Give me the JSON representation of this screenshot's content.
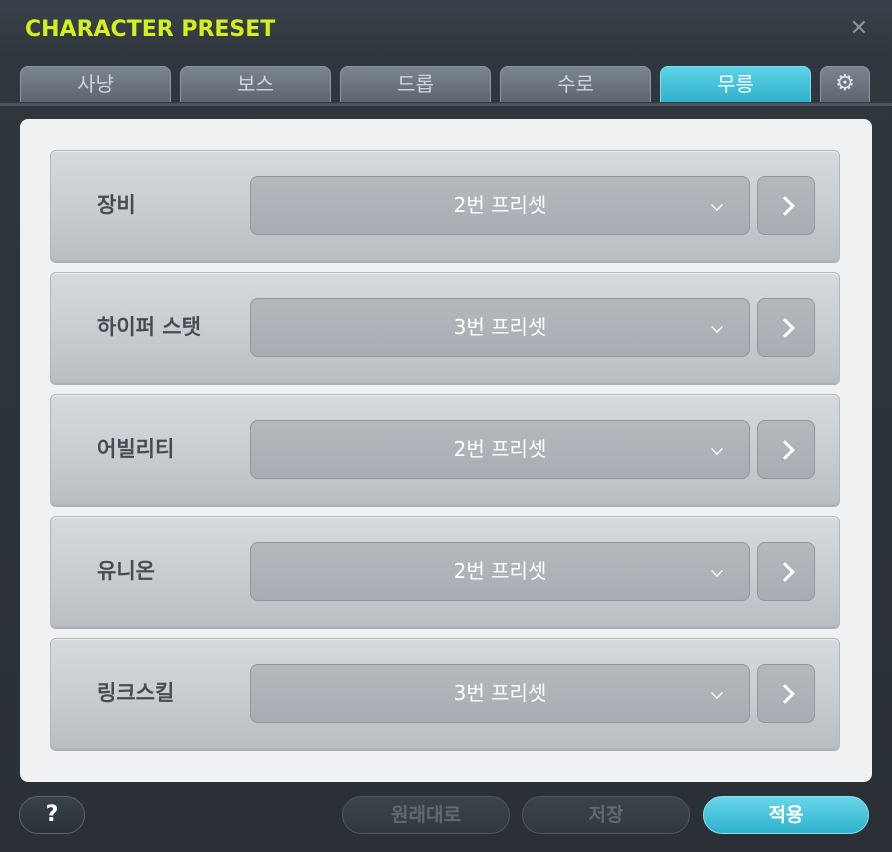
{
  "window": {
    "title": "CHARACTER PRESET",
    "close_symbol": "✕"
  },
  "tabs": [
    {
      "label": "사냥",
      "active": false
    },
    {
      "label": "보스",
      "active": false
    },
    {
      "label": "드롭",
      "active": false
    },
    {
      "label": "수로",
      "active": false
    },
    {
      "label": "무릉",
      "active": true
    }
  ],
  "settings_icon": "⚙",
  "rows": [
    {
      "label": "장비",
      "value": "2번 프리셋"
    },
    {
      "label": "하이퍼 스탯",
      "value": "3번 프리셋"
    },
    {
      "label": "어빌리티",
      "value": "2번 프리셋"
    },
    {
      "label": "유니온",
      "value": "2번 프리셋"
    },
    {
      "label": "링크스킬",
      "value": "3번 프리셋"
    }
  ],
  "footer": {
    "help_label": "?",
    "reset_label": "원래대로",
    "save_label": "저장",
    "apply_label": "적용"
  },
  "colors": {
    "title": "#d4f01e",
    "accent": "#2fb2cc"
  }
}
